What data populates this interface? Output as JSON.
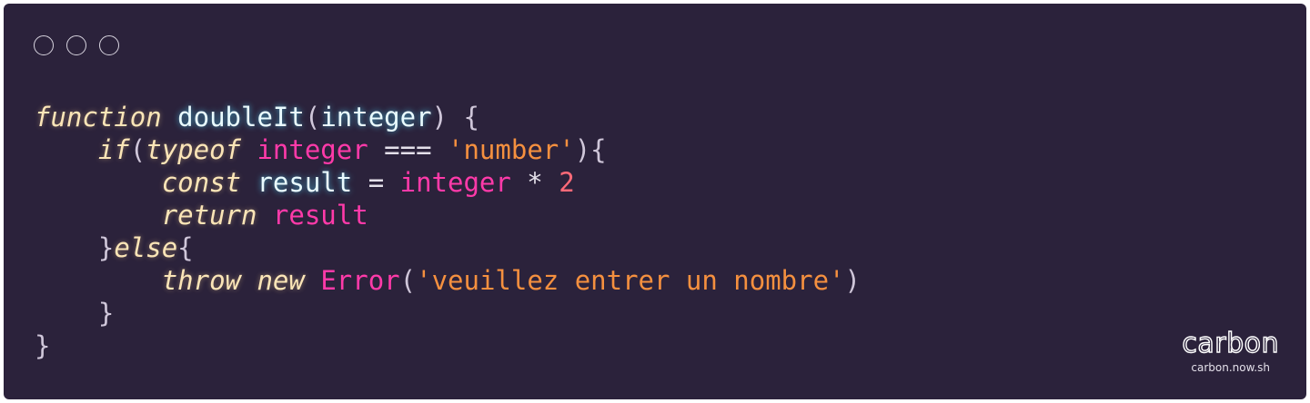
{
  "window_controls": [
    "close-control",
    "minimize-control",
    "maximize-control"
  ],
  "code": {
    "lines": [
      [
        {
          "t": "function",
          "c": "kw"
        },
        {
          "t": " ",
          "c": "pun"
        },
        {
          "t": "doubleIt",
          "c": "fn"
        },
        {
          "t": "(",
          "c": "pun"
        },
        {
          "t": "integer",
          "c": "fn"
        },
        {
          "t": ") {",
          "c": "pun"
        }
      ],
      [
        {
          "t": "    ",
          "c": "pun"
        },
        {
          "t": "if",
          "c": "kw"
        },
        {
          "t": "(",
          "c": "pun"
        },
        {
          "t": "typeof",
          "c": "kw"
        },
        {
          "t": " ",
          "c": "pun"
        },
        {
          "t": "integer",
          "c": "var"
        },
        {
          "t": " ",
          "c": "pun"
        },
        {
          "t": "===",
          "c": "op"
        },
        {
          "t": " ",
          "c": "pun"
        },
        {
          "t": "'number'",
          "c": "str"
        },
        {
          "t": "){",
          "c": "pun"
        }
      ],
      [
        {
          "t": "        ",
          "c": "pun"
        },
        {
          "t": "const",
          "c": "kw"
        },
        {
          "t": " ",
          "c": "pun"
        },
        {
          "t": "result",
          "c": "fn"
        },
        {
          "t": " = ",
          "c": "op"
        },
        {
          "t": "integer",
          "c": "var"
        },
        {
          "t": " * ",
          "c": "op"
        },
        {
          "t": "2",
          "c": "num"
        }
      ],
      [
        {
          "t": "        ",
          "c": "pun"
        },
        {
          "t": "return",
          "c": "kw"
        },
        {
          "t": " ",
          "c": "pun"
        },
        {
          "t": "result",
          "c": "var"
        }
      ],
      [
        {
          "t": "    ",
          "c": "pun"
        },
        {
          "t": "}",
          "c": "pun"
        },
        {
          "t": "else",
          "c": "kw"
        },
        {
          "t": "{",
          "c": "pun"
        }
      ],
      [
        {
          "t": "        ",
          "c": "pun"
        },
        {
          "t": "throw",
          "c": "kw"
        },
        {
          "t": " ",
          "c": "pun"
        },
        {
          "t": "new",
          "c": "kw"
        },
        {
          "t": " ",
          "c": "pun"
        },
        {
          "t": "Error",
          "c": "var"
        },
        {
          "t": "(",
          "c": "pun"
        },
        {
          "t": "'veuillez entrer un nombre'",
          "c": "str"
        },
        {
          "t": ")",
          "c": "pun"
        }
      ],
      [
        {
          "t": "    ",
          "c": "pun"
        },
        {
          "t": "}",
          "c": "pun"
        }
      ],
      [
        {
          "t": "}",
          "c": "pun"
        }
      ]
    ]
  },
  "brand": {
    "logo": "carbon",
    "url": "carbon.now.sh"
  },
  "colors": {
    "background": "#2b223b",
    "keyword": "#fbe5b7",
    "function_name": "#e9fbff",
    "variable": "#ff3aa9",
    "string": "#f5903f",
    "number": "#ff6a78",
    "punctuation": "#cfc6d9"
  }
}
